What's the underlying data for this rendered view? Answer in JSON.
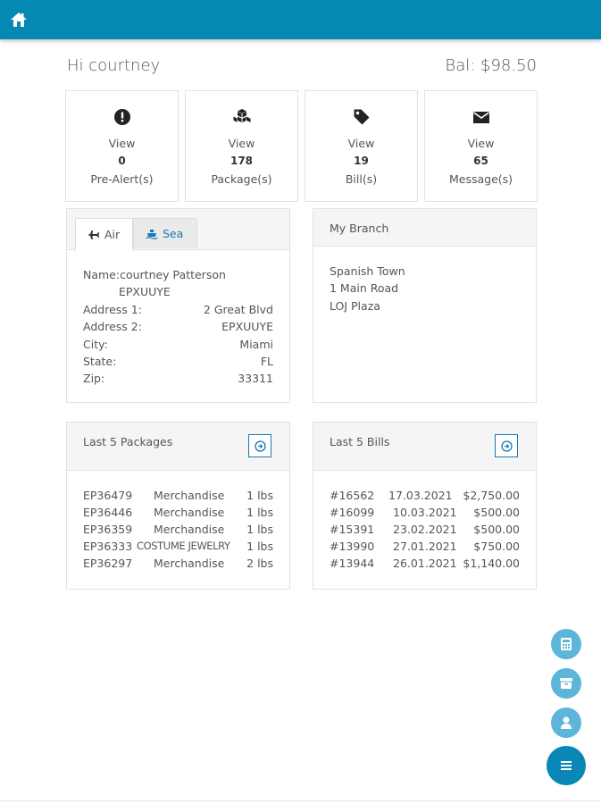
{
  "header": {
    "home_icon": "home-icon"
  },
  "greeting": "Hi courtney",
  "balance": "Bal: $98.50",
  "stats": [
    {
      "icon": "alert-icon",
      "view": "View",
      "count": "0",
      "label": "Pre-Alert(s)"
    },
    {
      "icon": "packages-icon",
      "view": "View",
      "count": "178",
      "label": "Package(s)"
    },
    {
      "icon": "tag-icon",
      "view": "View",
      "count": "19",
      "label": "Bill(s)"
    },
    {
      "icon": "envelope-icon",
      "view": "View",
      "count": "65",
      "label": "Message(s)"
    }
  ],
  "address_panel": {
    "tabs": [
      {
        "label": "Air",
        "icon": "plane-icon"
      },
      {
        "label": "Sea",
        "icon": "ship-icon"
      }
    ],
    "name": "Name:courtney Patterson",
    "code": "EPXUUYE",
    "rows": [
      {
        "key": "Address 1:",
        "value": "2 Great Blvd"
      },
      {
        "key": "Address 2:",
        "value": "EPXUUYE"
      },
      {
        "key": "City:",
        "value": "Miami"
      },
      {
        "key": "State:",
        "value": "FL"
      },
      {
        "key": "Zip:",
        "value": "33311"
      }
    ]
  },
  "branch_panel": {
    "title": "My Branch",
    "lines": [
      "Spanish Town",
      "1 Main Road",
      "LOJ Plaza"
    ]
  },
  "packages_panel": {
    "title": "Last 5 Packages",
    "rows": [
      {
        "id": "EP36479",
        "desc": "Merchandise",
        "weight": "1 lbs"
      },
      {
        "id": "EP36446",
        "desc": "Merchandise",
        "weight": "1 lbs"
      },
      {
        "id": "EP36359",
        "desc": "Merchandise",
        "weight": "1 lbs"
      },
      {
        "id": "EP36333",
        "desc": "COSTUME JEWELRY",
        "weight": "1 lbs"
      },
      {
        "id": "EP36297",
        "desc": "Merchandise",
        "weight": "2 lbs"
      }
    ]
  },
  "bills_panel": {
    "title": "Last 5 Bills",
    "rows": [
      {
        "id": "#16562",
        "date": "17.03.2021",
        "amount": "$2,750.00"
      },
      {
        "id": "#16099",
        "date": "10.03.2021",
        "amount": "$500.00"
      },
      {
        "id": "#15391",
        "date": "23.02.2021",
        "amount": "$500.00"
      },
      {
        "id": "#13990",
        "date": "27.01.2021",
        "amount": "$750.00"
      },
      {
        "id": "#13944",
        "date": "26.01.2021",
        "amount": "$1,140.00"
      }
    ]
  },
  "fabs": [
    "calculator-icon",
    "archive-icon",
    "user-icon",
    "menu-icon"
  ],
  "colors": {
    "brand": "#0589b3",
    "link": "#1a78b8",
    "fab_light": "#5bb6da"
  }
}
